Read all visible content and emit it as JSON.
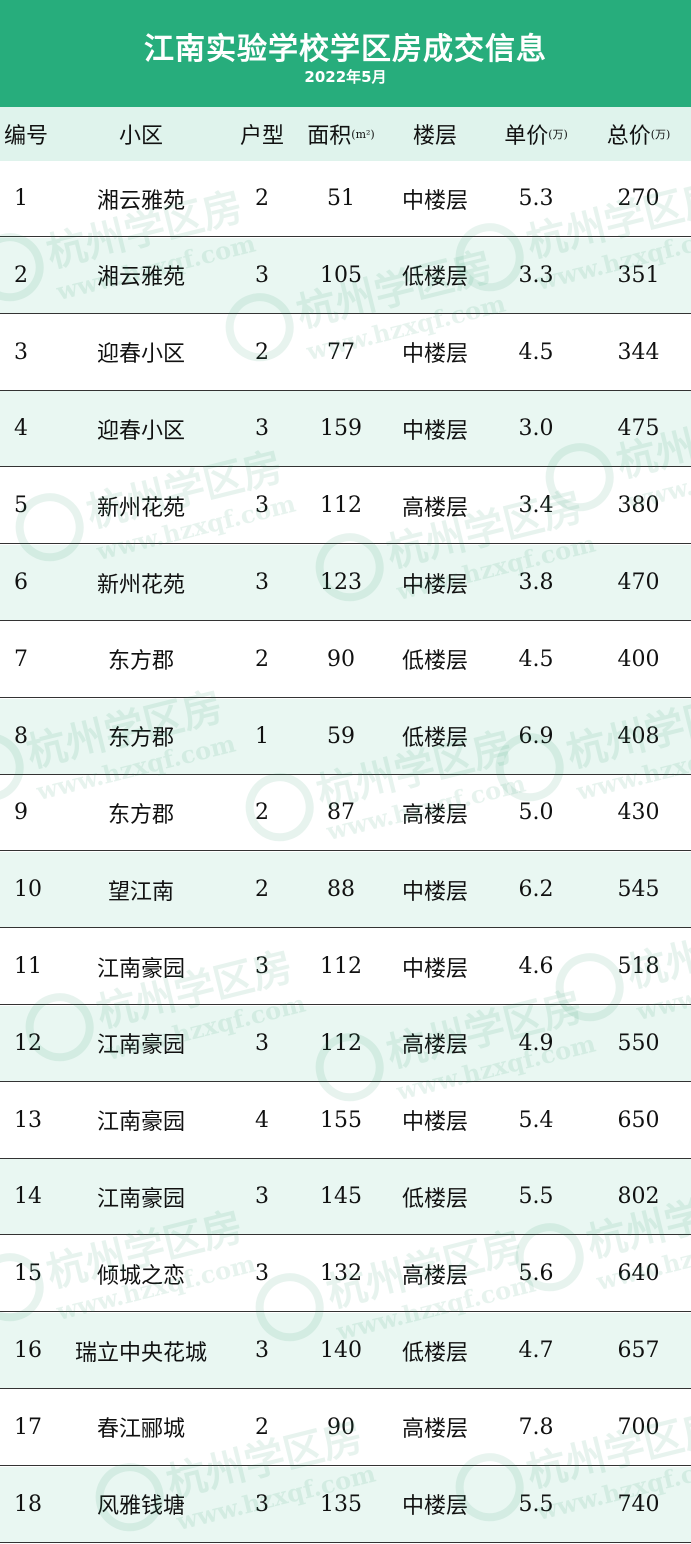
{
  "header": {
    "title": "江南实验学校学区房成交信息",
    "subtitle": "2022年5月"
  },
  "columns": {
    "no": "编号",
    "name": "小区",
    "type": "户型",
    "area": "面积",
    "area_unit": "(m²)",
    "floor": "楼层",
    "unit_price": "单价",
    "unit_price_unit": "(万)",
    "total_price": "总价",
    "total_price_unit": "(万)"
  },
  "rows": [
    {
      "no": "1",
      "name": "湘云雅苑",
      "type": "2",
      "area": "51",
      "floor": "中楼层",
      "unit_price": "5.3",
      "total_price": "270"
    },
    {
      "no": "2",
      "name": "湘云雅苑",
      "type": "3",
      "area": "105",
      "floor": "低楼层",
      "unit_price": "3.3",
      "total_price": "351"
    },
    {
      "no": "3",
      "name": "迎春小区",
      "type": "2",
      "area": "77",
      "floor": "中楼层",
      "unit_price": "4.5",
      "total_price": "344"
    },
    {
      "no": "4",
      "name": "迎春小区",
      "type": "3",
      "area": "159",
      "floor": "中楼层",
      "unit_price": "3.0",
      "total_price": "475"
    },
    {
      "no": "5",
      "name": "新州花苑",
      "type": "3",
      "area": "112",
      "floor": "高楼层",
      "unit_price": "3.4",
      "total_price": "380"
    },
    {
      "no": "6",
      "name": "新州花苑",
      "type": "3",
      "area": "123",
      "floor": "中楼层",
      "unit_price": "3.8",
      "total_price": "470"
    },
    {
      "no": "7",
      "name": "东方郡",
      "type": "2",
      "area": "90",
      "floor": "低楼层",
      "unit_price": "4.5",
      "total_price": "400"
    },
    {
      "no": "8",
      "name": "东方郡",
      "type": "1",
      "area": "59",
      "floor": "低楼层",
      "unit_price": "6.9",
      "total_price": "408"
    },
    {
      "no": "9",
      "name": "东方郡",
      "type": "2",
      "area": "87",
      "floor": "高楼层",
      "unit_price": "5.0",
      "total_price": "430"
    },
    {
      "no": "10",
      "name": "望江南",
      "type": "2",
      "area": "88",
      "floor": "中楼层",
      "unit_price": "6.2",
      "total_price": "545"
    },
    {
      "no": "11",
      "name": "江南豪园",
      "type": "3",
      "area": "112",
      "floor": "中楼层",
      "unit_price": "4.6",
      "total_price": "518"
    },
    {
      "no": "12",
      "name": "江南豪园",
      "type": "3",
      "area": "112",
      "floor": "高楼层",
      "unit_price": "4.9",
      "total_price": "550"
    },
    {
      "no": "13",
      "name": "江南豪园",
      "type": "4",
      "area": "155",
      "floor": "中楼层",
      "unit_price": "5.4",
      "total_price": "650"
    },
    {
      "no": "14",
      "name": "江南豪园",
      "type": "3",
      "area": "145",
      "floor": "低楼层",
      "unit_price": "5.5",
      "total_price": "802"
    },
    {
      "no": "15",
      "name": "倾城之恋",
      "type": "3",
      "area": "132",
      "floor": "高楼层",
      "unit_price": "5.6",
      "total_price": "640"
    },
    {
      "no": "16",
      "name": "瑞立中央花城",
      "type": "3",
      "area": "140",
      "floor": "低楼层",
      "unit_price": "4.7",
      "total_price": "657"
    },
    {
      "no": "17",
      "name": "春江郦城",
      "type": "2",
      "area": "90",
      "floor": "高楼层",
      "unit_price": "7.8",
      "total_price": "700"
    },
    {
      "no": "18",
      "name": "风雅钱塘",
      "type": "3",
      "area": "135",
      "floor": "中楼层",
      "unit_price": "5.5",
      "total_price": "740"
    }
  ],
  "watermark": {
    "text_cn": "杭州学区房",
    "text_url": "www.hzxqf.com"
  },
  "colors": {
    "header_bg": "#27ad7c",
    "row_alt_bg": "#e9f7f2",
    "col_header_bg": "#dff3ec"
  }
}
